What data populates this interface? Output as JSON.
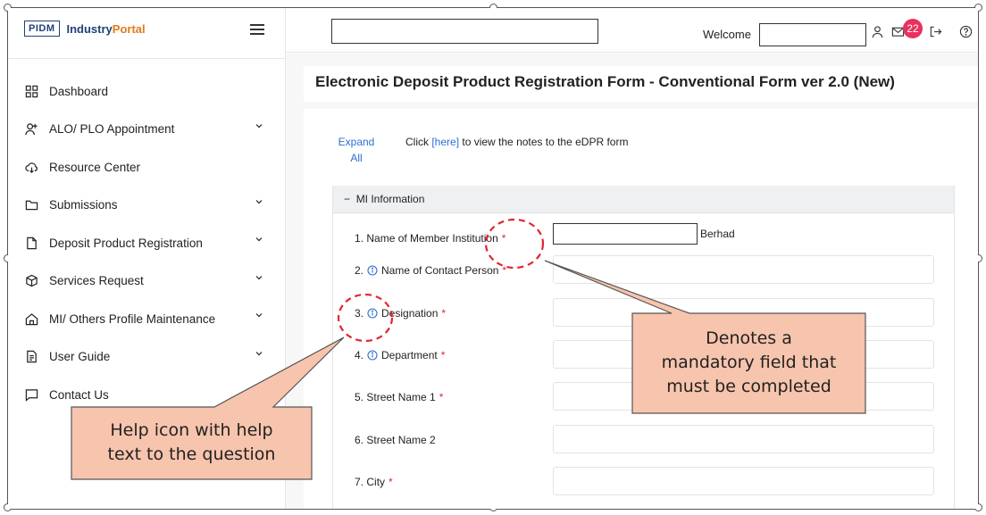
{
  "brand": {
    "logo_text": "PIDM",
    "name_part1": "Industry",
    "name_part2": "Portal"
  },
  "sidebar": {
    "items": [
      {
        "label": "Dashboard",
        "icon": "dashboard-icon",
        "has_chevron": false
      },
      {
        "label": "ALO/ PLO Appointment",
        "icon": "user-add-icon",
        "has_chevron": true
      },
      {
        "label": "Resource Center",
        "icon": "cloud-download-icon",
        "has_chevron": false
      },
      {
        "label": "Submissions",
        "icon": "folder-icon",
        "has_chevron": true
      },
      {
        "label": "Deposit Product Registration",
        "icon": "file-icon",
        "has_chevron": true
      },
      {
        "label": "Services Request",
        "icon": "box-icon",
        "has_chevron": true
      },
      {
        "label": "MI/ Others Profile Maintenance",
        "icon": "home-icon",
        "has_chevron": true
      },
      {
        "label": "User Guide",
        "icon": "document-icon",
        "has_chevron": true
      },
      {
        "label": "Contact Us",
        "icon": "message-icon",
        "has_chevron": false
      }
    ]
  },
  "header": {
    "search_value": "",
    "welcome_label": "Welcome",
    "welcome_value": "",
    "notification_count": "22"
  },
  "main": {
    "title": "Electronic Deposit Product Registration Form - Conventional Form ver 2.0 (New)",
    "expand_label_1": "Expand",
    "expand_label_2": "All",
    "notes_prefix": "Click ",
    "notes_link": "[here]",
    "notes_suffix": " to view the notes to the eDPR form",
    "section_title": "MI Information",
    "section_toggle": "−",
    "mi_suffix": "Berhad",
    "questions": [
      {
        "number": "1.",
        "label": "Name of Member Institution",
        "info": false,
        "required": true
      },
      {
        "number": "2.",
        "label": "Name of Contact Person",
        "info": true,
        "required": true
      },
      {
        "number": "3.",
        "label": "Designation",
        "info": true,
        "required": true
      },
      {
        "number": "4.",
        "label": "Department",
        "info": true,
        "required": true
      },
      {
        "number": "5.",
        "label": "Street Name 1",
        "info": false,
        "required": true
      },
      {
        "number": "6.",
        "label": "Street Name 2",
        "info": false,
        "required": false
      },
      {
        "number": "7.",
        "label": "City",
        "info": false,
        "required": true
      }
    ],
    "required_mark": "*"
  },
  "annotations": {
    "mandatory_callout": [
      "Denotes a",
      "mandatory field that",
      "must be completed"
    ],
    "help_callout": [
      "Help icon with help",
      "text to the question"
    ],
    "callout_fill": "#f7c4ad"
  },
  "colors": {
    "accent": "#2e6fd1",
    "badge": "#e8315e",
    "required": "#e0262e",
    "brand": "#23407a"
  }
}
